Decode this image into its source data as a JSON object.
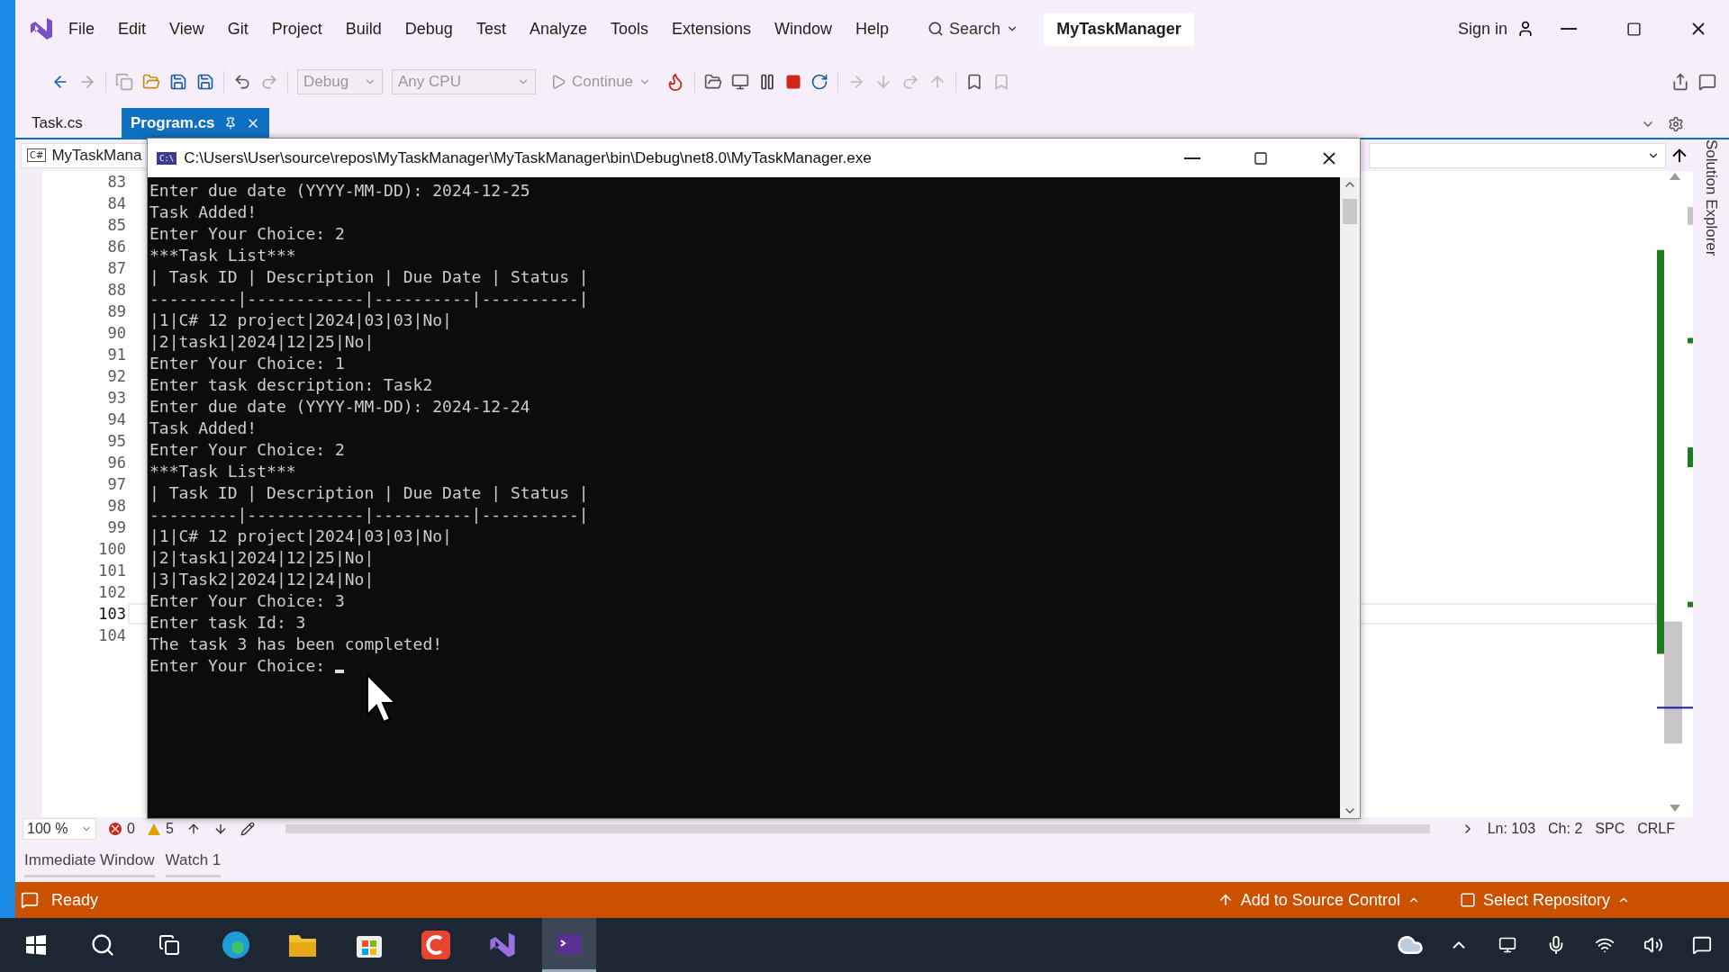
{
  "menu": [
    {
      "label": "File"
    },
    {
      "label": "Edit"
    },
    {
      "label": "View"
    },
    {
      "label": "Git"
    },
    {
      "label": "Project"
    },
    {
      "label": "Build"
    },
    {
      "label": "Debug"
    },
    {
      "label": "Test"
    },
    {
      "label": "Analyze"
    },
    {
      "label": "Tools"
    },
    {
      "label": "Extensions"
    },
    {
      "label": "Window"
    },
    {
      "label": "Help"
    }
  ],
  "search": {
    "label": "Search"
  },
  "solution_name": "MyTaskManager",
  "sign_in": "Sign in",
  "toolbar": {
    "configuration": "Debug",
    "platform": "Any CPU",
    "continue": "Continue"
  },
  "tabs": [
    {
      "label": "Task.cs",
      "selected": false
    },
    {
      "label": "Program.cs",
      "selected": true
    }
  ],
  "editor": {
    "file_badge": "C#",
    "project": "MyTaskMana",
    "line_numbers": [
      {
        "number": "83",
        "current": false
      },
      {
        "number": "84",
        "current": false
      },
      {
        "number": "85",
        "current": false
      },
      {
        "number": "86",
        "current": false
      },
      {
        "number": "87",
        "current": false
      },
      {
        "number": "88",
        "current": false
      },
      {
        "number": "89",
        "current": false
      },
      {
        "number": "90",
        "current": false
      },
      {
        "number": "91",
        "current": false
      },
      {
        "number": "92",
        "current": false
      },
      {
        "number": "93",
        "current": false
      },
      {
        "number": "94",
        "current": false
      },
      {
        "number": "95",
        "current": false
      },
      {
        "number": "96",
        "current": false
      },
      {
        "number": "97",
        "current": false
      },
      {
        "number": "98",
        "current": false
      },
      {
        "number": "99",
        "current": false
      },
      {
        "number": "100",
        "current": false
      },
      {
        "number": "101",
        "current": false
      },
      {
        "number": "102",
        "current": false
      },
      {
        "number": "103",
        "current": true
      },
      {
        "number": "104",
        "current": false
      }
    ]
  },
  "side_panel": {
    "label": "Solution Explorer"
  },
  "editor_status": {
    "zoom": "100 %",
    "errors": "0",
    "warnings": "5",
    "line": "Ln: 103",
    "column": "Ch: 2",
    "whitespace": "SPC",
    "line_ending": "CRLF"
  },
  "bottom_tabs": [
    {
      "label": "Immediate Window"
    },
    {
      "label": "Watch 1"
    }
  ],
  "status_bar": {
    "state": "Ready",
    "source_control": "Add to Source Control",
    "repository": "Select Repository"
  },
  "console": {
    "icon_text": "C:\\",
    "title": "C:\\Users\\User\\source\\repos\\MyTaskManager\\MyTaskManager\\bin\\Debug\\net8.0\\MyTaskManager.exe",
    "lines": [
      "Enter due date (YYYY-MM-DD): 2024-12-25",
      "Task Added!",
      "Enter Your Choice: 2",
      "***Task List***",
      "| Task ID | Description | Due Date | Status |",
      "---------|------------|----------|----------|",
      "|1|C# 12 project|2024|03|03|No|",
      "|2|task1|2024|12|25|No|",
      "Enter Your Choice: 1",
      "Enter task description: Task2",
      "Enter due date (YYYY-MM-DD): 2024-12-24",
      "Task Added!",
      "Enter Your Choice: 2",
      "***Task List***",
      "| Task ID | Description | Due Date | Status |",
      "---------|------------|----------|----------|",
      "|1|C# 12 project|2024|03|03|No|",
      "|2|task1|2024|12|25|No|",
      "|3|Task2|2024|12|24|No|",
      "Enter Your Choice: 3",
      "Enter task Id: 3",
      "The task 3 has been completed!",
      "Enter Your Choice: "
    ]
  }
}
